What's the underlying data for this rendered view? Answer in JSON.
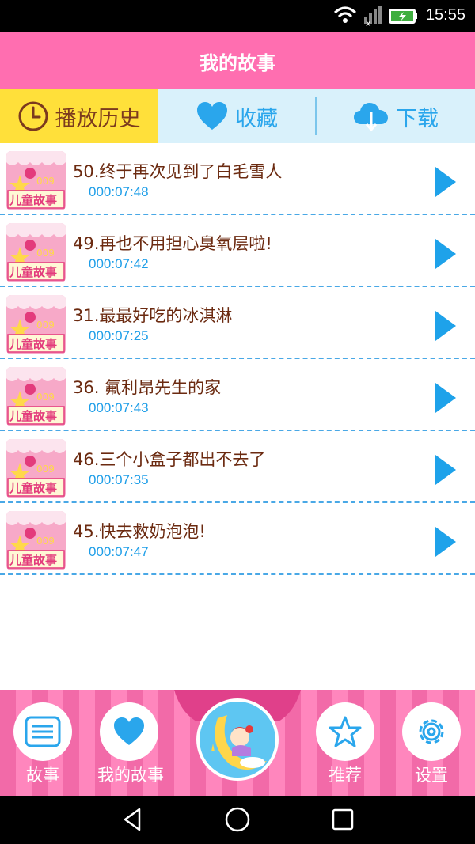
{
  "status_bar": {
    "time": "15:55"
  },
  "header": {
    "title": "我的故事"
  },
  "tabs": [
    {
      "label": "播放历史",
      "icon": "clock-icon",
      "active": true
    },
    {
      "label": "收藏",
      "icon": "heart-icon",
      "active": false
    },
    {
      "label": "下载",
      "icon": "cloud-download-icon",
      "active": false
    }
  ],
  "thumbnail": {
    "badge_number": "009",
    "badge_text": "儿童故事"
  },
  "stories": [
    {
      "title": "50.终于再次见到了白毛雪人",
      "duration": "000:07:48"
    },
    {
      "title": "49.再也不用担心臭氧层啦!",
      "duration": "000:07:42"
    },
    {
      "title": "31.最最好吃的冰淇淋",
      "duration": "000:07:25"
    },
    {
      "title": "36. 氟利昂先生的家",
      "duration": "000:07:43"
    },
    {
      "title": "46.三个小盒子都出不去了",
      "duration": "000:07:35"
    },
    {
      "title": "45.快去救奶泡泡!",
      "duration": "000:07:47"
    }
  ],
  "bottom_nav": [
    {
      "label": "故事",
      "icon": "list-icon"
    },
    {
      "label": "我的故事",
      "icon": "heart-icon"
    },
    {
      "label": "推荐",
      "icon": "star-icon"
    },
    {
      "label": "设置",
      "icon": "gear-icon"
    }
  ],
  "colors": {
    "header": "#ff6eb0",
    "tab_active": "#ffe03a",
    "tab_bar": "#d9f1fb",
    "accent_blue": "#2aa6ec",
    "title_brown": "#6b2a10"
  }
}
